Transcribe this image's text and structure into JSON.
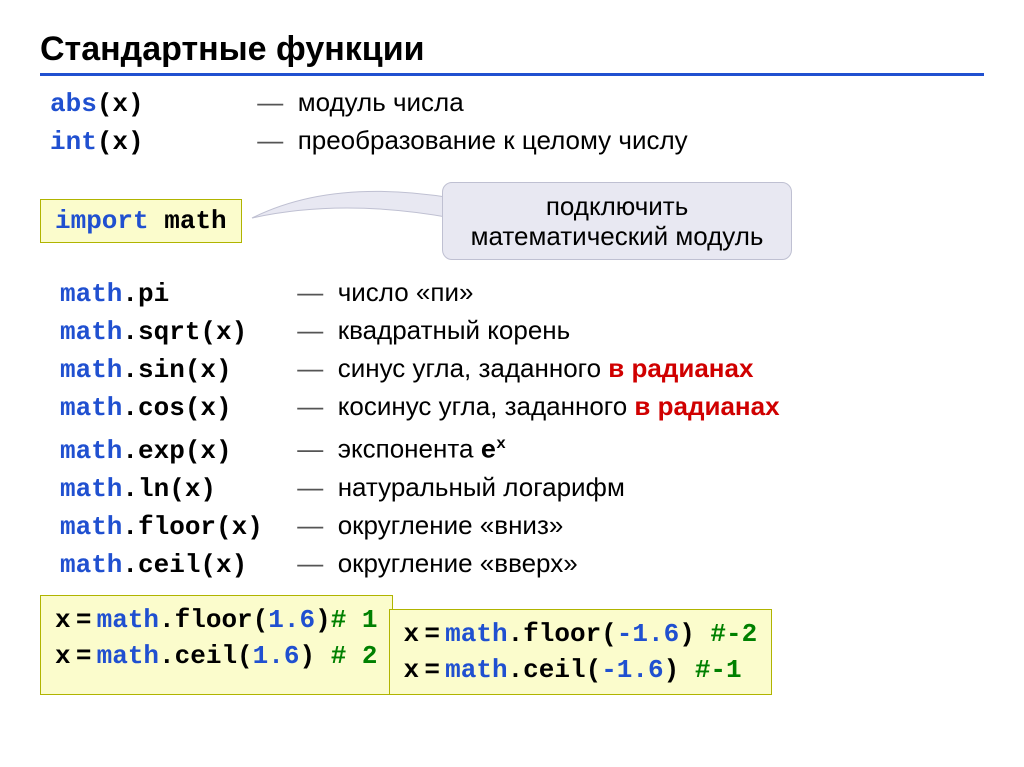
{
  "title": "Стандартные функции",
  "top": {
    "abs": {
      "fn_pre": "abs",
      "fn_args": "(x)",
      "desc": "модуль числа"
    },
    "int": {
      "fn_pre": "int",
      "fn_args": "(x)",
      "desc": "преобразование к целому числу"
    }
  },
  "import": {
    "kw": "import",
    "mod": "math"
  },
  "callout": {
    "line1": "подключить",
    "line2": "математический модуль"
  },
  "dash": "—",
  "math": {
    "pi": {
      "obj": "math",
      "dot": ".pi",
      "desc": "число «пи»"
    },
    "sqrt": {
      "obj": "math",
      "dot": ".sqrt(x)",
      "desc": "квадратный корень"
    },
    "sin": {
      "obj": "math",
      "dot": ".sin(x)",
      "desc_pre": "синус угла, заданного ",
      "desc_red": "в радианах"
    },
    "cos": {
      "obj": "math",
      "dot": ".cos(x)",
      "desc_pre": "косинус угла, заданного ",
      "desc_red": "в радианах"
    },
    "exp": {
      "obj": "math",
      "dot": ".exp(x)",
      "desc_pre": "экспонента ",
      "e": "e",
      "x": "x"
    },
    "ln": {
      "obj": "math",
      "dot": ".ln(x)",
      "desc": "натуральный логарифм"
    },
    "floor": {
      "obj": "math",
      "dot": ".floor(x)",
      "desc": "округление «вниз»"
    },
    "ceil": {
      "obj": "math",
      "dot": ".ceil(x)",
      "desc": "округление «вверх»"
    }
  },
  "boxA": {
    "l1": {
      "a": "x",
      "eq": "=",
      "obj": "math",
      "fn": ".floor(",
      "num": "1.6",
      "close": ")",
      "cm": "# 1"
    },
    "l2": {
      "a": "x",
      "eq": "=",
      "obj": "math",
      "fn": ".ceil(",
      "num": "1.6",
      "close": ") ",
      "cm": "# 2"
    }
  },
  "boxB": {
    "l1": {
      "a": "x",
      "eq": "=",
      "obj": "math",
      "fn": ".floor(",
      "num": "-1.6",
      "close": ") ",
      "cm": "#-2"
    },
    "l2": {
      "a": "x",
      "eq": "=",
      "obj": "math",
      "fn": ".ceil(",
      "num": "-1.6",
      "close": ")  ",
      "cm": "#-1"
    }
  }
}
